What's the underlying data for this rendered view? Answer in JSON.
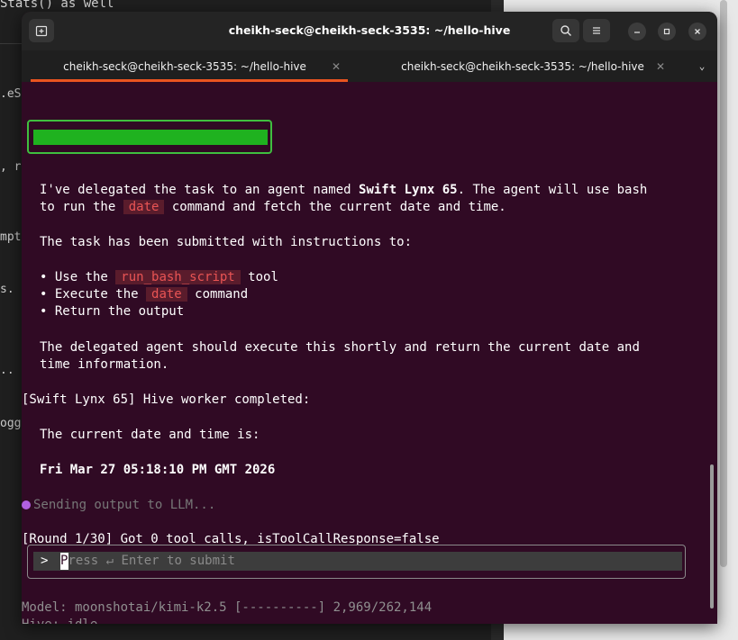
{
  "background": {
    "top_text": "Stats() as well",
    "left_fragments": [
      ".eSt",
      ", r",
      "mpt",
      "s.",
      "..",
      "ogg"
    ]
  },
  "window": {
    "title": "cheikh-seck@cheikh-seck-3535: ~/hello-hive",
    "tabs": [
      {
        "label": "cheikh-seck@cheikh-seck-3535: ~/hello-hive",
        "active": true
      },
      {
        "label": "cheikh-seck@cheikh-seck-3535: ~/hello-hive",
        "active": false
      }
    ],
    "icons": {
      "new_tab": "new-tab-icon",
      "search": "search-icon",
      "menu": "hamburger-menu-icon",
      "minimize": "minimize-icon",
      "maximize": "maximize-icon",
      "close": "close-icon"
    },
    "accent": "#e95420",
    "terminal_bg": "#300a24"
  },
  "terminal": {
    "msg1_pre": "I've delegated the task to an agent named ",
    "msg1_agent": "Swift Lynx 65",
    "msg1_post": ". The agent will use bash",
    "msg2_pre": "to run the ",
    "msg2_code": "date",
    "msg2_post": " command and fetch the current date and time.",
    "msg3": "The task has been submitted with instructions to:",
    "bullet1_pre": "• Use the ",
    "bullet1_code": "run_bash_script",
    "bullet1_post": " tool",
    "bullet2_pre": "• Execute the ",
    "bullet2_code": "date",
    "bullet2_post": " command",
    "bullet3": "• Return the output",
    "msg4": "The delegated agent should execute this shortly and return the current date and",
    "msg5": "time information.",
    "worker_done": "[Swift Lynx 65] Hive worker completed:",
    "msg6": "The current date and time is:",
    "datetime": "Fri Mar 27 05:18:10 PM GMT 2026",
    "sending": "Sending output to LLM...",
    "round": "[Round 1/30] Got 0 tool calls, isToolCallResponse=false",
    "prompt_symbol": ">",
    "input_placeholder_first": "P",
    "input_placeholder_rest": "ress ↵ Enter to submit",
    "status_model": "Model: moonshotai/kimi-k2.5 [----------] 2,969/262,144",
    "status_hive": "Hive: idle",
    "colors": {
      "progress": "#1fb21f",
      "code_fg": "#e95454",
      "spinner": "#b060e0"
    }
  }
}
